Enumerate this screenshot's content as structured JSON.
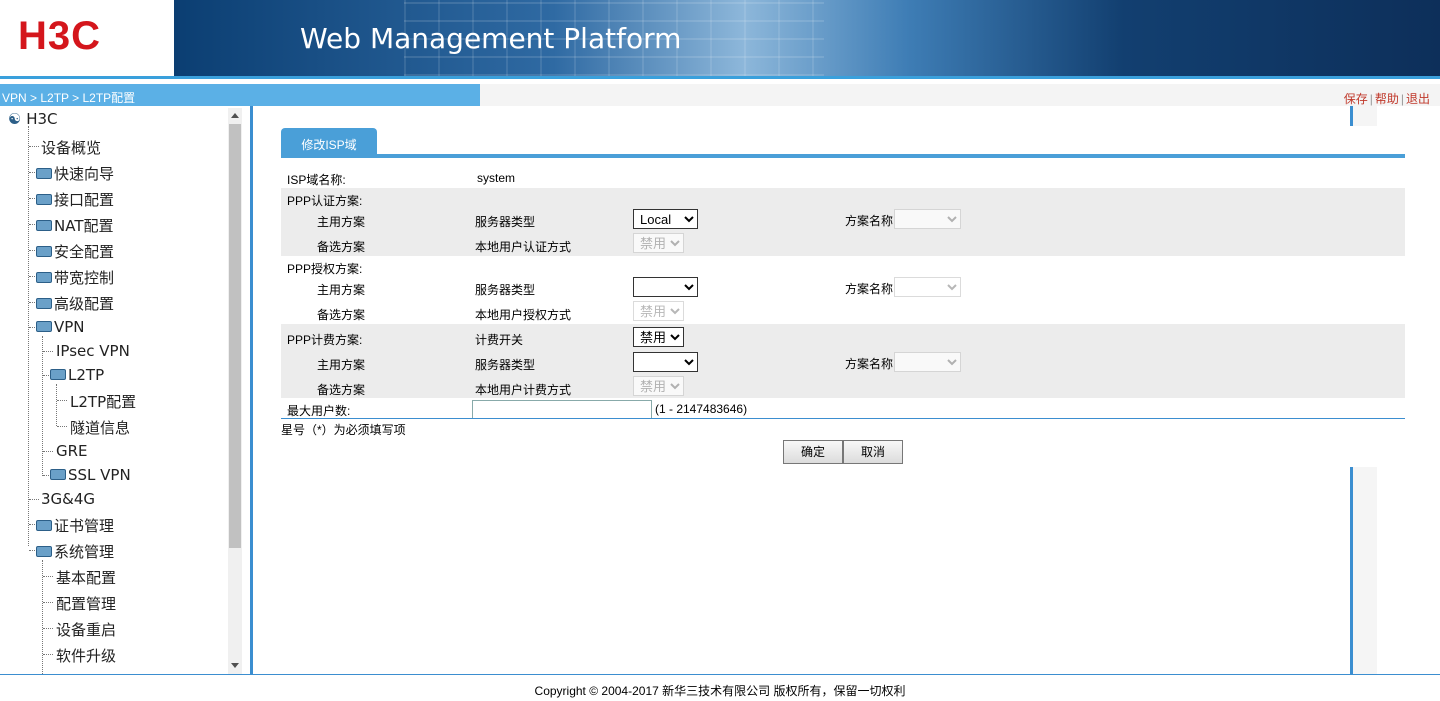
{
  "header": {
    "logo": "H3C",
    "title": "Web Management Platform"
  },
  "breadcrumb": "VPN > L2TP > L2TP配置",
  "toplinks": {
    "save": "保存",
    "help": "帮助",
    "logout": "退出"
  },
  "sidebar": {
    "root": "H3C",
    "items": [
      {
        "label": "设备概览"
      },
      {
        "label": "快速向导"
      },
      {
        "label": "接口配置"
      },
      {
        "label": "NAT配置"
      },
      {
        "label": "安全配置"
      },
      {
        "label": "带宽控制"
      },
      {
        "label": "高级配置"
      },
      {
        "label": "VPN"
      },
      {
        "label": "IPsec VPN"
      },
      {
        "label": "L2TP"
      },
      {
        "label": "L2TP配置"
      },
      {
        "label": "隧道信息"
      },
      {
        "label": "GRE"
      },
      {
        "label": "SSL VPN"
      },
      {
        "label": "3G&4G"
      },
      {
        "label": "证书管理"
      },
      {
        "label": "系统管理"
      },
      {
        "label": "基本配置"
      },
      {
        "label": "配置管理"
      },
      {
        "label": "设备重启"
      },
      {
        "label": "软件升级"
      }
    ]
  },
  "tab": "修改ISP域",
  "form": {
    "isp_label": "ISP域名称:",
    "isp_value": "system",
    "auth_label": "PPP认证方案:",
    "primary": "主用方案",
    "backup": "备选方案",
    "server_type": "服务器类型",
    "scheme_name": "方案名称",
    "local_auth_mode": "本地用户认证方式",
    "authz_label": "PPP授权方案:",
    "local_authz_mode": "本地用户授权方式",
    "acct_label": "PPP计费方案:",
    "acct_switch": "计费开关",
    "local_acct_mode": "本地用户计费方式",
    "auth_server_value": "Local",
    "disabled_value": "禁用",
    "acct_switch_value": "禁用",
    "max_users_label": "最大用户数:",
    "max_users_value": "",
    "max_users_range": "(1 - 2147483646)",
    "required_note": "星号（*）为必须填写项"
  },
  "buttons": {
    "ok": "确定",
    "cancel": "取消"
  },
  "footer": "Copyright © 2004-2017 新华三技术有限公司 版权所有，保留一切权利"
}
